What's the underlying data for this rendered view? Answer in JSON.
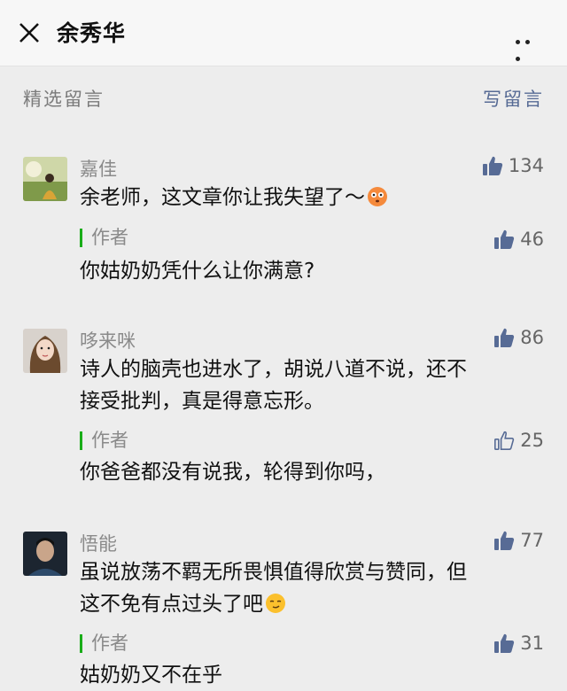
{
  "header": {
    "title": "余秀华",
    "close_icon": "close-icon",
    "more_icon": "more-icon"
  },
  "section": {
    "title": "精选留言",
    "write_label": "写留言"
  },
  "comments": [
    {
      "name": "嘉佳",
      "likes": "134",
      "line1": "余老师，这文章你让我失望了～",
      "emoji": "flushed-face-emoji",
      "reply": {
        "label": "作者",
        "likes": "46",
        "text": "你姑奶奶凭什么让你满意?"
      }
    },
    {
      "name": "哆来咪",
      "likes": "86",
      "line1": "诗人的脑壳也进水了，胡说八道不说，还不",
      "line2": "接受批判，真是得意忘形。",
      "reply": {
        "label": "作者",
        "likes": "25",
        "text": "你爸爸都没有说我，轮得到你吗，"
      }
    },
    {
      "name": "悟能",
      "likes": "77",
      "line1": "虽说放荡不羁无所畏惧值得欣赏与赞同，但",
      "line2": "这不免有点过头了吧",
      "emoji": "smirk-face-emoji",
      "reply": {
        "label": "作者",
        "likes": "31",
        "text": "姑奶奶又不在乎"
      }
    }
  ],
  "colors": {
    "accent": "#1aad19",
    "link": "#576b95",
    "muted": "#8a8a8a",
    "background": "#ededed"
  }
}
